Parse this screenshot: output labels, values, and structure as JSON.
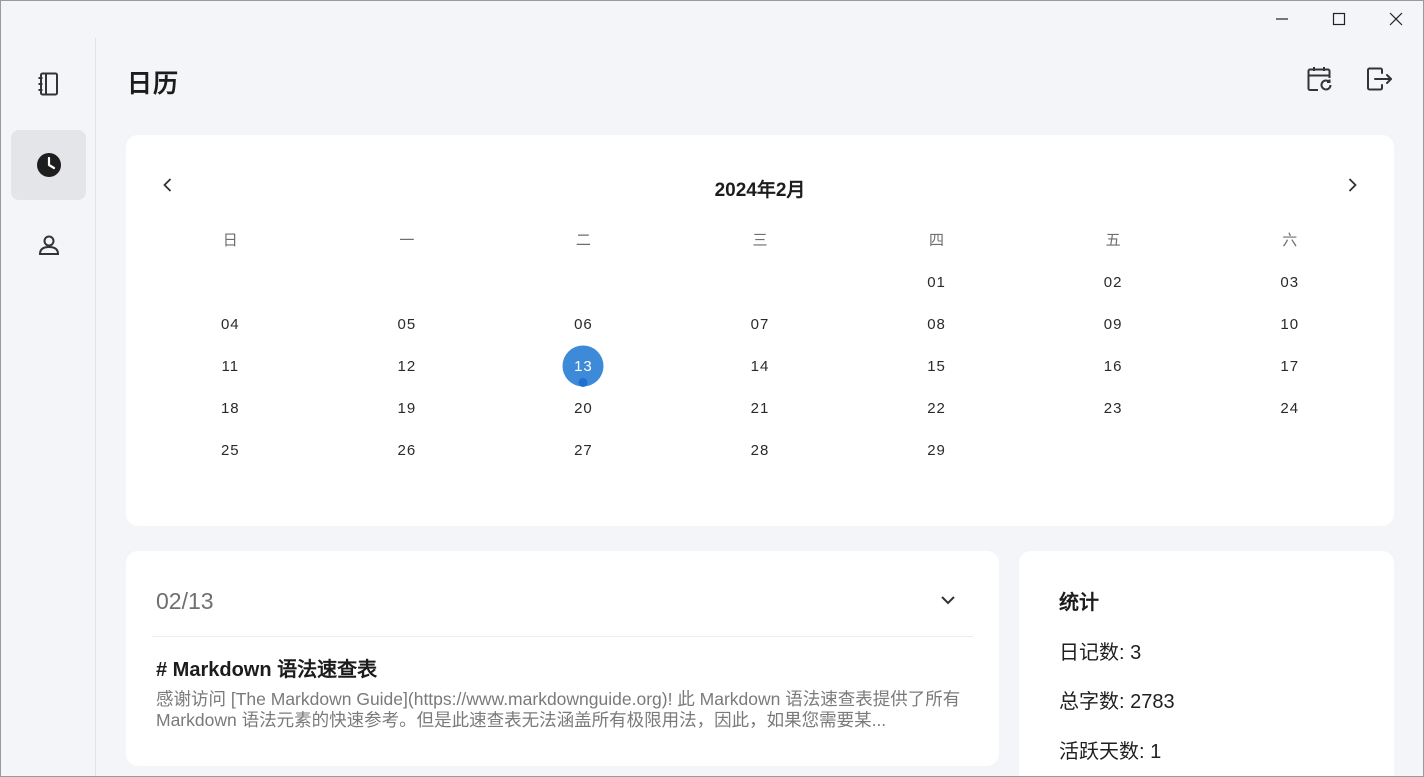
{
  "window": {
    "minimize_icon": "minimize-icon",
    "maximize_icon": "maximize-icon",
    "close_icon": "close-icon"
  },
  "sidebar": {
    "items": [
      {
        "id": "notebook",
        "icon": "notebook-icon",
        "active": false
      },
      {
        "id": "calendar",
        "icon": "clock-icon",
        "active": true
      },
      {
        "id": "profile",
        "icon": "person-icon",
        "active": false
      }
    ]
  },
  "header": {
    "title": "日历",
    "actions": [
      {
        "id": "calendar-refresh",
        "icon": "calendar-refresh-icon"
      },
      {
        "id": "export",
        "icon": "export-icon"
      }
    ]
  },
  "calendar": {
    "title": "2024年2月",
    "weekdays": [
      "日",
      "一",
      "二",
      "三",
      "四",
      "五",
      "六"
    ],
    "leading_blanks": 4,
    "days": [
      "01",
      "02",
      "03",
      "04",
      "05",
      "06",
      "07",
      "08",
      "09",
      "10",
      "11",
      "12",
      "13",
      "14",
      "15",
      "16",
      "17",
      "18",
      "19",
      "20",
      "21",
      "22",
      "23",
      "24",
      "25",
      "26",
      "27",
      "28",
      "29"
    ],
    "selected_day": "13",
    "days_with_entries": [
      "13"
    ],
    "accent_color": "#3d8ad9"
  },
  "entry": {
    "date": "02/13",
    "title": "# Markdown 语法速查表",
    "preview": "感谢访问 [The Markdown Guide](https://www.markdownguide.org)! 此 Markdown 语法速查表提供了所有 Markdown 语法元素的快速参考。但是此速查表无法涵盖所有极限用法，因此，如果您需要某..."
  },
  "stats": {
    "title": "统计",
    "entries_label": "日记数: 3",
    "words_label": "总字数: 2783",
    "active_days_label": "活跃天数: 1"
  }
}
